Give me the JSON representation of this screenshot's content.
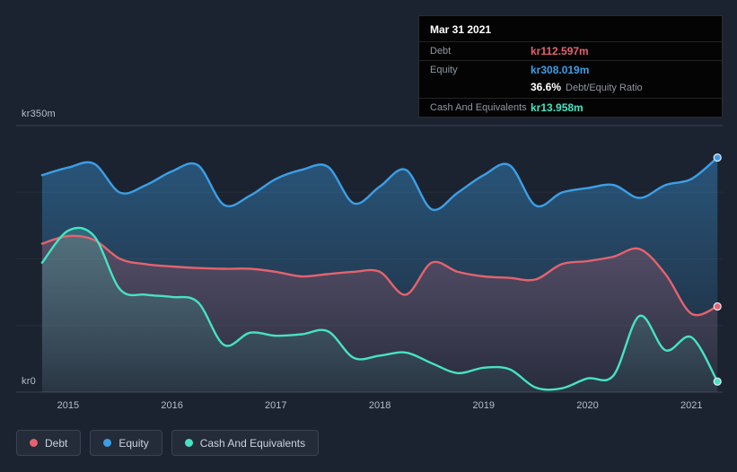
{
  "colors": {
    "background": "#1c2330",
    "debt": "#e4636e",
    "equity": "#3c9fe6",
    "cash": "#46e3c3",
    "grid": "#3a424f",
    "tooltip_bg": "#040404",
    "legend_bg": "#242b39"
  },
  "tooltip": {
    "date": "Mar 31 2021",
    "debt_label": "Debt",
    "debt_value": "kr112.597m",
    "equity_label": "Equity",
    "equity_value": "kr308.019m",
    "ratio_value": "36.6%",
    "ratio_label": "Debt/Equity Ratio",
    "cash_label": "Cash And Equivalents",
    "cash_value": "kr13.958m"
  },
  "axis": {
    "y_top_label": "kr350m",
    "y_bottom_label": "kr0"
  },
  "legend": [
    {
      "label": "Debt",
      "color_key": "debt"
    },
    {
      "label": "Equity",
      "color_key": "equity"
    },
    {
      "label": "Cash And Equivalents",
      "color_key": "cash"
    }
  ],
  "chart_data": {
    "type": "area",
    "unit": "kr millions",
    "x": [
      2014.75,
      2015.0,
      2015.25,
      2015.5,
      2015.75,
      2016.0,
      2016.25,
      2016.5,
      2016.75,
      2017.0,
      2017.25,
      2017.5,
      2017.75,
      2018.0,
      2018.25,
      2018.5,
      2018.75,
      2019.0,
      2019.25,
      2019.5,
      2019.75,
      2020.0,
      2020.25,
      2020.5,
      2020.75,
      2021.0,
      2021.25
    ],
    "series": [
      {
        "name": "Debt",
        "color_key": "debt",
        "values": [
          195,
          205,
          200,
          175,
          168,
          165,
          163,
          162,
          162,
          158,
          152,
          155,
          158,
          158,
          128,
          170,
          158,
          152,
          150,
          148,
          168,
          172,
          178,
          188,
          155,
          103,
          112.597
        ]
      },
      {
        "name": "Equity",
        "color_key": "equity",
        "values": [
          285,
          295,
          300,
          262,
          272,
          290,
          298,
          246,
          258,
          280,
          292,
          296,
          248,
          270,
          292,
          240,
          262,
          285,
          298,
          245,
          262,
          268,
          272,
          255,
          272,
          280,
          308.019
        ]
      },
      {
        "name": "Cash And Equivalents",
        "color_key": "cash",
        "values": [
          170,
          212,
          205,
          135,
          128,
          125,
          118,
          62,
          78,
          74,
          76,
          80,
          45,
          48,
          52,
          38,
          25,
          32,
          30,
          6,
          5,
          18,
          22,
          100,
          55,
          72,
          13.958
        ]
      }
    ],
    "ylim": [
      0,
      350
    ],
    "xlim": [
      2014.5,
      2021.3
    ],
    "x_ticks": [
      2015,
      2016,
      2017,
      2018,
      2019,
      2020,
      2021
    ],
    "y_tick_labels": [
      "kr0",
      "kr350m"
    ],
    "grid": "horizontal",
    "legend_position": "bottom-left",
    "last_point_date": "Mar 31 2021"
  }
}
